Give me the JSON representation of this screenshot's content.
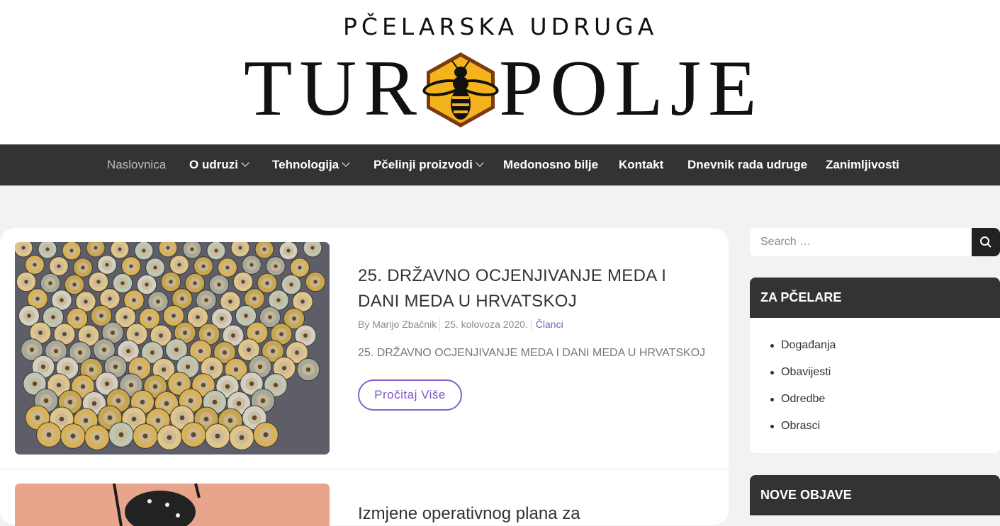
{
  "header": {
    "tagline": "PČELARSKA UDRUGA",
    "logo_left": "TUR",
    "logo_right": "POLJE",
    "logo_icon": "bee-hexagon-icon"
  },
  "nav": {
    "items": [
      {
        "label": "Naslovnica"
      },
      {
        "label": "O udruzi"
      },
      {
        "label": "Tehnologija"
      },
      {
        "label": "Pčelinji proizvodi"
      },
      {
        "label": "Medonosno bilje"
      },
      {
        "label": "Kontakt"
      },
      {
        "label": "Dnevnik rada udruge"
      },
      {
        "label": "Zanimljivosti"
      }
    ]
  },
  "posts": [
    {
      "title": "25. DRŽAVNO OCJENJIVANJE MEDA I DANI MEDA U HRVATSKOJ",
      "author": "By Marijo Zbačnik",
      "date": "25. kolovoza 2020.",
      "category": "Članci",
      "excerpt": "25. DRŽAVNO OCJENJIVANJE MEDA I DANI MEDA U HRVATSKOJ",
      "read_more": "Pročitaj Više"
    },
    {
      "title": "Izmjene operativnog plana za"
    }
  ],
  "sidebar": {
    "search_placeholder": "Search …",
    "search_icon": "search-icon",
    "widget1": {
      "title": "ZA PČELARE",
      "items": [
        "Događanja",
        "Obavijesti",
        "Odredbe",
        "Obrasci"
      ]
    },
    "widget2": {
      "title": "NOVE OBJAVE"
    }
  },
  "colors": {
    "nav_bg": "#333333",
    "accent": "#7b57c0",
    "page_bg": "#f2f2f2"
  }
}
